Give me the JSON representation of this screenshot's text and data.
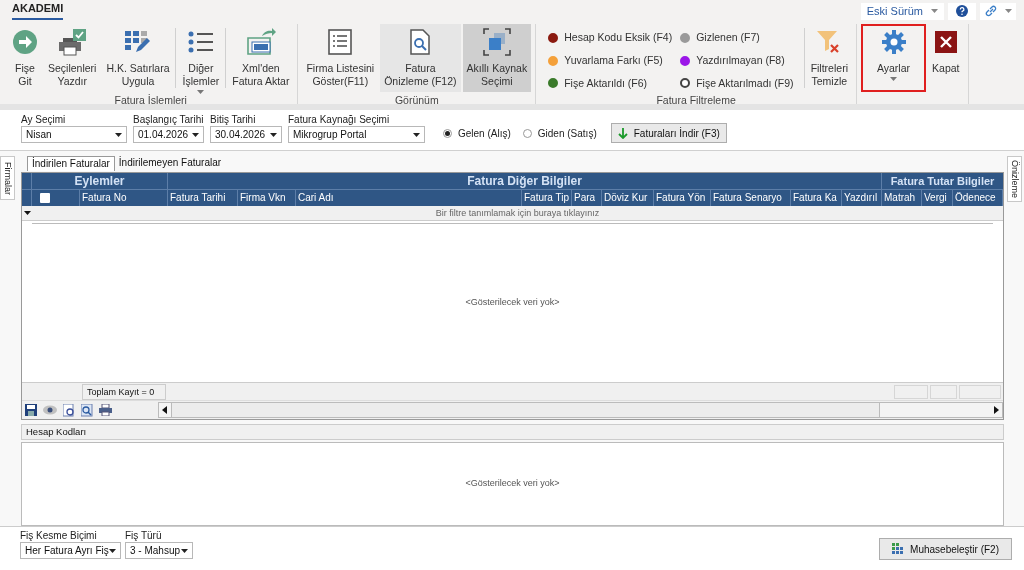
{
  "top_tab": {
    "label": "AKADEMI",
    "selected": true
  },
  "top_right": {
    "version_dropdown": "Eski Sürüm"
  },
  "ribbon": {
    "groups": [
      {
        "label": "Fatura İşlemleri",
        "buttons": [
          {
            "label": "Fişe\nGit"
          },
          {
            "label": "Seçilenleri\nYazdır"
          },
          {
            "label": "H.K. Satırlara\nUygula"
          },
          {
            "label": "Diğer\nİşlemler",
            "dropdown": true,
            "separator_before": true
          },
          {
            "label": "Xml'den\nFatura Aktar",
            "separator_before": true
          }
        ]
      },
      {
        "label": "Görünüm",
        "buttons": [
          {
            "label": "Firma Listesini\nGöster(F11)",
            "hovered": false,
            "pressed": false
          },
          {
            "label": "Fatura\nÖnizleme (F12)",
            "hovered": true,
            "pressed": false
          },
          {
            "label": "Akıllı Kaynak\nSeçimi",
            "hovered": false,
            "pressed": true
          }
        ]
      },
      {
        "label": "Fatura Filtreleme",
        "legend": [
          {
            "label": "Hesap Kodu Eksik (F4)",
            "color": "#8b1a10",
            "hollow": false
          },
          {
            "label": "Yuvarlama Farkı (F5)",
            "color": "#f4a03a",
            "hollow": false
          },
          {
            "label": "Fişe Aktarıldı (F6)",
            "color": "#3a7a2a",
            "hollow": false
          },
          {
            "label": "Gizlenen (F7)",
            "color": "#9a9a9a",
            "hollow": false
          },
          {
            "label": "Yazdırılmayan (F8)",
            "color": "#9b17e8",
            "hollow": false
          },
          {
            "label": "Fişe Aktarılmadı (F9)",
            "color": "#444444",
            "hollow": true
          }
        ],
        "buttons": [
          {
            "label": "Filtreleri\nTemizle",
            "separator_before": true
          }
        ]
      },
      {
        "buttons": [
          {
            "label": "Ayarlar",
            "dropdown": true,
            "outlined": true
          },
          {
            "label": "Kapat",
            "outlined": false
          }
        ]
      }
    ]
  },
  "filters": {
    "month": {
      "label": "Ay Seçimi",
      "value": "Nisan"
    },
    "start_date": {
      "label": "Başlangıç Tarihi",
      "value": "01.04.2026"
    },
    "end_date": {
      "label": "Bitiş Tarihi",
      "value": "30.04.2026"
    },
    "source": {
      "label": "Fatura Kaynağı Seçimi",
      "value": "Mikrogrup Portal"
    },
    "direction": [
      {
        "label": "Gelen (Alış)",
        "selected": true
      },
      {
        "label": "Giden (Satış)",
        "selected": false
      }
    ],
    "download_button": "Faturaları İndir (F3)"
  },
  "side_tabs": {
    "left": "Firmalar",
    "right": "Önizleme"
  },
  "grid": {
    "tabs": [
      {
        "label": "İndirilen Faturalar",
        "selected": true
      },
      {
        "label": "İndirilemeyen Faturalar",
        "selected": false
      }
    ],
    "group_headers": [
      "Eylemler",
      "Fatura Diğer Bilgiler",
      "Fatura Tutar Bilgiler"
    ],
    "select_all": {
      "checked": false
    },
    "columns": [
      "Fatura No",
      "Fatura Tarihi",
      "Firma Vkn",
      "Cari Adı",
      "Fatura Tip",
      "Para",
      "Döviz Kur",
      "Fatura Yön",
      "Fatura Senaryo",
      "Fatura Ka",
      "Yazdırıl",
      "Matrah",
      "Vergi",
      "Ödenece"
    ],
    "filter_hint": "Bir filtre tanımlamak için buraya tıklayınız",
    "empty_text": "<Gösterilecek veri yok>",
    "total": "Toplam Kayıt = 0"
  },
  "account_codes": {
    "title": "Hesap Kodları",
    "empty_text": "<Gösterilecek veri yok>"
  },
  "bottom": {
    "slip_mode": {
      "label": "Fiş Kesme Biçimi",
      "value": "Her Fatura Ayrı Fiş"
    },
    "slip_type": {
      "label": "Fiş Türü",
      "value": "3 - Mahsup"
    },
    "post_button": "Muhasebeleştir (F2)"
  }
}
